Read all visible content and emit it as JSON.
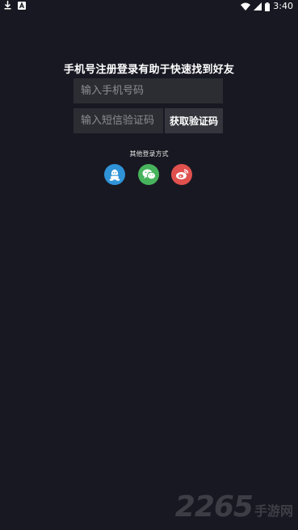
{
  "status_bar": {
    "time": "3:40",
    "icons": [
      "download-icon",
      "notification-a-icon",
      "wifi-icon",
      "cell-signal-icon",
      "battery-icon"
    ]
  },
  "login": {
    "title": "手机号注册登录有助于快速找到好友",
    "phone_placeholder": "输入手机号码",
    "code_placeholder": "输入短信验证码",
    "code_button": "获取验证码",
    "other_methods_label": "其他登录方式",
    "social": [
      {
        "name": "qq",
        "icon": "qq-penguin-icon",
        "color": "#2f93d8"
      },
      {
        "name": "wechat",
        "icon": "wechat-icon",
        "color": "#47b35c"
      },
      {
        "name": "weibo",
        "icon": "weibo-icon",
        "color": "#e0514e"
      }
    ]
  },
  "watermark": {
    "number": "2265",
    "text": "手游网"
  },
  "colors": {
    "background": "#181822",
    "input_bg": "#2b2d33",
    "button_bg": "#35363d"
  }
}
